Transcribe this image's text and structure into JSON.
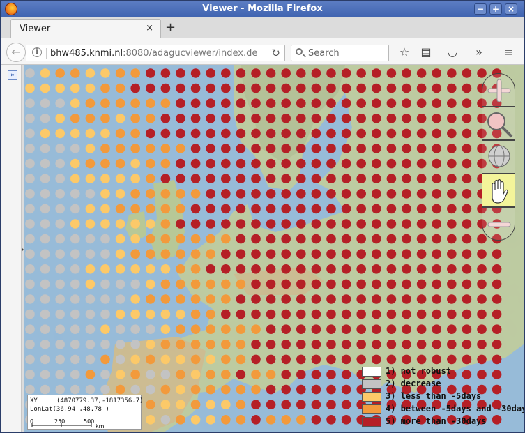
{
  "window": {
    "title": "Viewer - Mozilla Firefox",
    "buttons": [
      "−",
      "+",
      "×"
    ]
  },
  "tabs": [
    {
      "label": "Viewer",
      "close": "×"
    }
  ],
  "new_tab_label": "+",
  "navbar": {
    "back_icon": "arrow-left-icon",
    "url_host": "bhw485.knmi.nl",
    "url_rest": ":8080/adagucviewer/index.de",
    "reload_glyph": "↻",
    "search_placeholder": "Search",
    "toolbar_glyphs": {
      "bookmark": "☆",
      "reading_list": "▤",
      "pocket": "◡",
      "overflow": "»",
      "menu": "≡"
    }
  },
  "sidepanel": {
    "toggle_label": "»"
  },
  "map": {
    "navigation_tools": [
      "zoom-in",
      "zoom-box",
      "zoom-to-extent",
      "pan",
      "zoom-out"
    ],
    "legend": [
      {
        "label": "1) not robust",
        "color": "#ffffff"
      },
      {
        "label": "2) decrease",
        "color": "#c3c3c3"
      },
      {
        "label": "3) less than -5days",
        "color": "#fcc969"
      },
      {
        "label": "4) between -5days and -30days",
        "color": "#f29a3c"
      },
      {
        "label": "5) more than -30days",
        "color": "#b51f26"
      }
    ],
    "coords": {
      "xy_label": "XY",
      "xy_value": "(4870779.37,-1817356.7)",
      "lonlat_label": "LonLat",
      "lonlat_value": "(36.94       ,48.78      )",
      "scale_ticks": [
        "0",
        "250",
        "500"
      ],
      "scale_unit": "km"
    }
  },
  "colors": {
    "land": "#b9c79a",
    "sea": "#8fb6d6",
    "titlebar": "#4a6dba"
  }
}
